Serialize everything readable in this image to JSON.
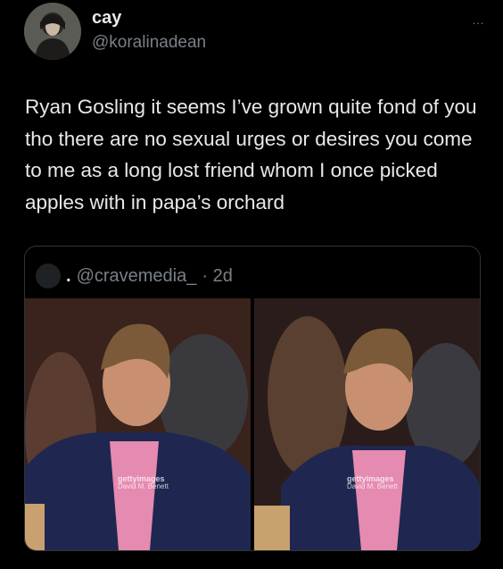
{
  "author": {
    "name": "cay",
    "handle": "@koralinadean"
  },
  "more_icon": "…",
  "tweet_text": "Ryan Gosling it seems I’ve grown quite fond of you tho there are no sexual urges or desires you come to me as a long lost friend whom I once picked apples with in papa’s orchard",
  "quoted": {
    "separator": ".",
    "handle": "@cravemedia_",
    "time": "· 2d",
    "photos": [
      {
        "watermark": "gettyimages",
        "credit": "David M. Benett"
      },
      {
        "watermark": "gettyimages",
        "credit": "David M. Benett"
      }
    ]
  },
  "icons": [
    "avatar",
    "more-icon",
    "quoted-avatar"
  ]
}
